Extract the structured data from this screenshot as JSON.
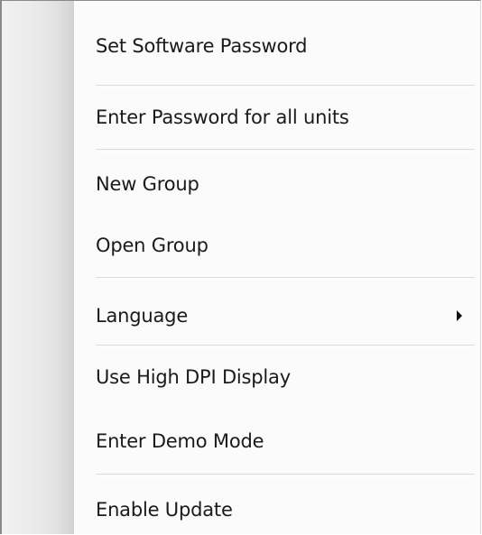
{
  "menu": {
    "items": [
      {
        "label": "Set Software Password"
      },
      {
        "label": "Enter Password for all units"
      },
      {
        "label": "New Group"
      },
      {
        "label": "Open Group"
      },
      {
        "label": "Language",
        "submenu_icon": "chevron-right-icon"
      },
      {
        "label": "Use High DPI Display"
      },
      {
        "label": "Enter Demo Mode"
      },
      {
        "label": "Enable Update"
      }
    ]
  }
}
